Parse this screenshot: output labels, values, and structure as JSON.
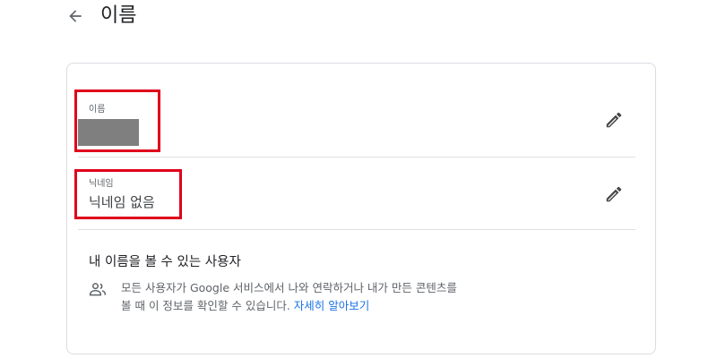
{
  "header": {
    "title": "이름"
  },
  "fields": {
    "name": {
      "label": "이름",
      "value": ""
    },
    "nickname": {
      "label": "닉네임",
      "value": "닉네임 없음"
    }
  },
  "visibility": {
    "title": "내 이름을 볼 수 있는 사용자",
    "description": "모든 사용자가 Google 서비스에서 나와 연락하거나 내가 만든 콘텐츠를 볼 때 이 정보를 확인할 수 있습니다. ",
    "learn_more": "자세히 알아보기"
  },
  "icons": {
    "back": "arrow-back-icon",
    "edit": "pencil-icon",
    "people": "people-icon"
  },
  "colors": {
    "highlight": "#e0001b",
    "link": "#1a73e8",
    "redacted": "#7f7f7f"
  }
}
